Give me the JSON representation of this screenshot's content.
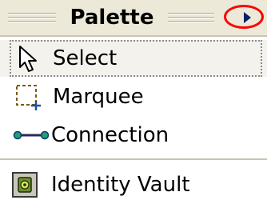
{
  "palette": {
    "title": "Palette",
    "collapse_icon": "triangle-right-icon",
    "highlight_color": "#ff0000",
    "tools": [
      {
        "label": "Select",
        "icon": "arrow-cursor-icon",
        "selected": true
      },
      {
        "label": "Marquee",
        "icon": "marquee-icon",
        "selected": false
      },
      {
        "label": "Connection",
        "icon": "connection-icon",
        "selected": false
      }
    ],
    "objects": [
      {
        "label": "Identity Vault",
        "icon": "identity-vault-icon"
      }
    ]
  }
}
